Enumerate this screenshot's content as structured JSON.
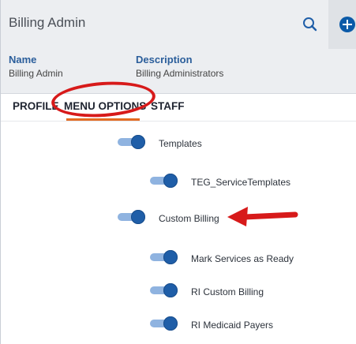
{
  "header": {
    "title": "Billing Admin",
    "fields": {
      "name_label": "Name",
      "name_value": "Billing Admin",
      "description_label": "Description",
      "description_value": "Billing Administrators"
    }
  },
  "tabs": [
    {
      "label": "PROFILE"
    },
    {
      "label": "MENU OPTIONS"
    },
    {
      "label": "STAFF"
    }
  ],
  "menu_options": [
    {
      "label": "Templates",
      "enabled": true
    },
    {
      "label": "TEG_ServiceTemplates",
      "enabled": true
    },
    {
      "label": "Custom Billing",
      "enabled": true
    },
    {
      "label": "Mark Services as Ready",
      "enabled": true
    },
    {
      "label": "RI Custom Billing",
      "enabled": true
    },
    {
      "label": "RI Medicaid Payers",
      "enabled": true
    }
  ],
  "colors": {
    "accent": "#1f5ea8",
    "tab_underline": "#e46b22",
    "annotation_red": "#d71a1a"
  },
  "icons": [
    "search-icon",
    "add-icon",
    "red-arrow-icon"
  ]
}
